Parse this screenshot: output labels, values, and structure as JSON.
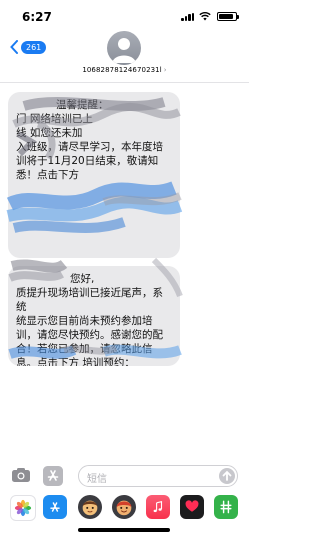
{
  "status_bar": {
    "time": "6:27"
  },
  "header": {
    "back_count": "261",
    "contact_number": "10682878124670231l"
  },
  "messages": [
    {
      "lines": [
        "温馨提醒：",
        "门 网络培训已上",
        "线 如您还未加",
        "入班级，请尽早学习，本年度培",
        "训将于11月20日结束，敬请知",
        "悉！点击下方"
      ]
    },
    {
      "lines": [
        "您好,",
        "质提升现场培训已接近尾声，系统",
        "统显示您目前尚未预约参加培",
        "训，请您尽快预约。感谢您的配",
        "合！若您已参加，请忽略此信",
        "息。点击下方 培训预约："
      ]
    }
  ],
  "input": {
    "placeholder": "短信"
  },
  "app_strip": [
    "photos-icon",
    "app-store-icon",
    "memoji-icon",
    "memoji-icon-2",
    "music-icon",
    "heart-app-icon",
    "green-app-icon"
  ]
}
